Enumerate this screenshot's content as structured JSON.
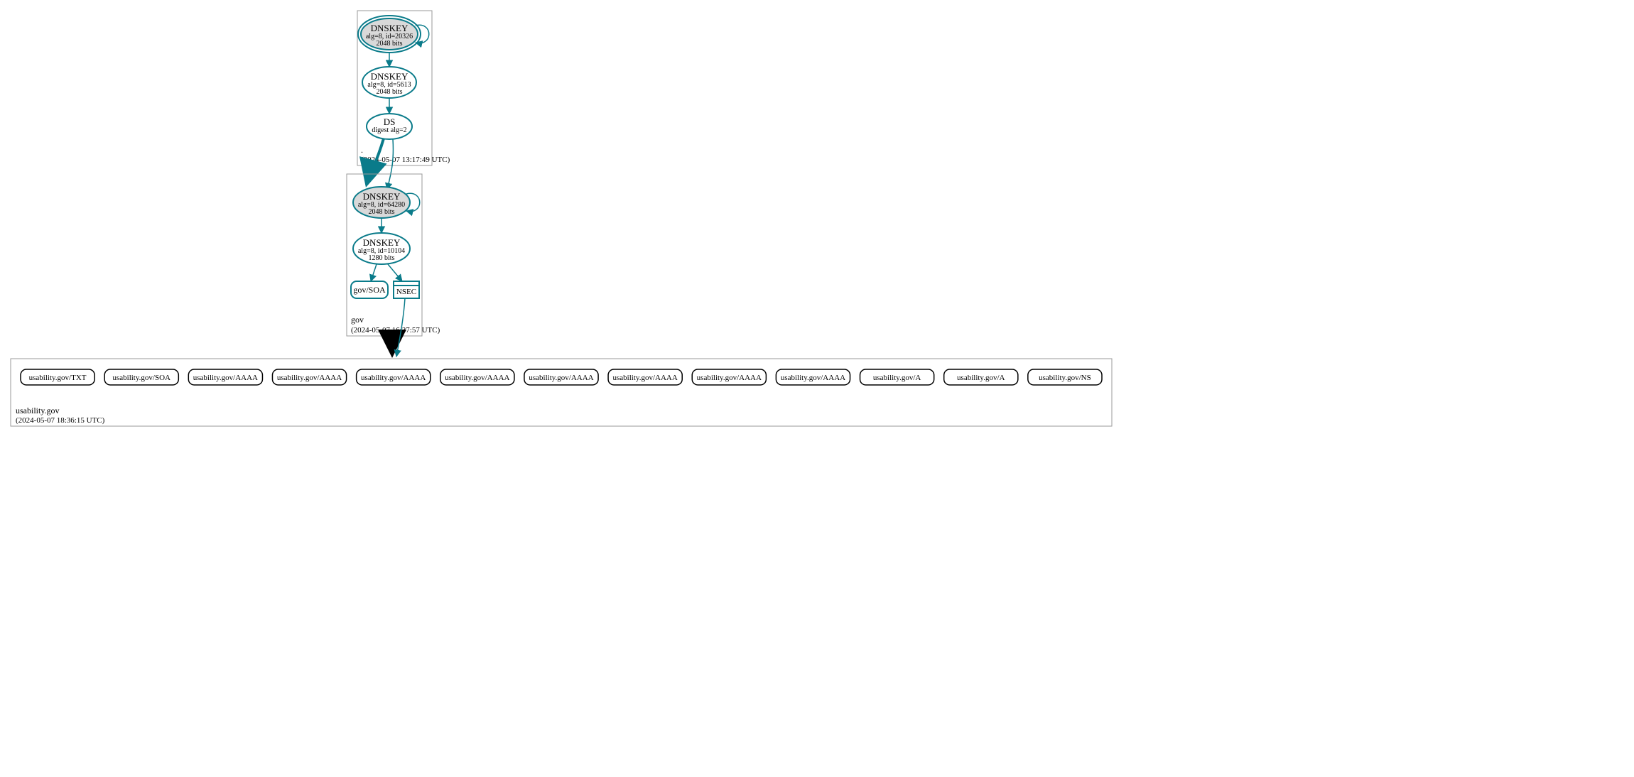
{
  "zones": {
    "root": {
      "name": ".",
      "timestamp": "(2024-05-07 13:17:49 UTC)"
    },
    "gov": {
      "name": "gov",
      "timestamp": "(2024-05-07 16:37:57 UTC)"
    },
    "usability": {
      "name": "usability.gov",
      "timestamp": "(2024-05-07 18:36:15 UTC)"
    }
  },
  "nodes": {
    "root_ksk": {
      "title": "DNSKEY",
      "line2": "alg=8, id=20326",
      "line3": "2048 bits"
    },
    "root_zsk": {
      "title": "DNSKEY",
      "line2": "alg=8, id=5613",
      "line3": "2048 bits"
    },
    "root_ds": {
      "title": "DS",
      "line2": "digest alg=2"
    },
    "gov_ksk": {
      "title": "DNSKEY",
      "line2": "alg=8, id=64280",
      "line3": "2048 bits"
    },
    "gov_zsk": {
      "title": "DNSKEY",
      "line2": "alg=8, id=10104",
      "line3": "1280 bits"
    },
    "gov_soa": {
      "title": "gov/SOA"
    },
    "gov_nsec": {
      "title": "NSEC"
    }
  },
  "leaves": [
    "usability.gov/TXT",
    "usability.gov/SOA",
    "usability.gov/AAAA",
    "usability.gov/AAAA",
    "usability.gov/AAAA",
    "usability.gov/AAAA",
    "usability.gov/AAAA",
    "usability.gov/AAAA",
    "usability.gov/AAAA",
    "usability.gov/AAAA",
    "usability.gov/A",
    "usability.gov/A",
    "usability.gov/NS"
  ]
}
